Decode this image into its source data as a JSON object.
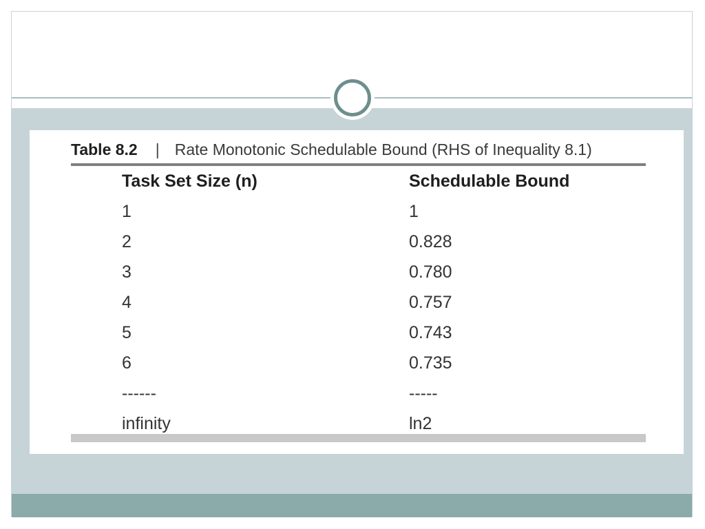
{
  "caption": {
    "label": "Table 8.2",
    "separator": "|",
    "title": "Rate Monotonic Schedulable Bound (RHS of Inequality 8.1)"
  },
  "table": {
    "headers": [
      "Task Set Size (n)",
      "Schedulable Bound"
    ],
    "rows": [
      [
        "1",
        "1"
      ],
      [
        "2",
        "0.828"
      ],
      [
        "3",
        "0.780"
      ],
      [
        "4",
        "0.757"
      ],
      [
        "5",
        "0.743"
      ],
      [
        "6",
        "0.735"
      ],
      [
        "------",
        "-----"
      ],
      [
        "infinity",
        "ln2"
      ]
    ]
  },
  "theme": {
    "body_band": "#c6d4d7",
    "footer_band": "#8aabaa",
    "ornament_ring": "#6d8f8d"
  }
}
